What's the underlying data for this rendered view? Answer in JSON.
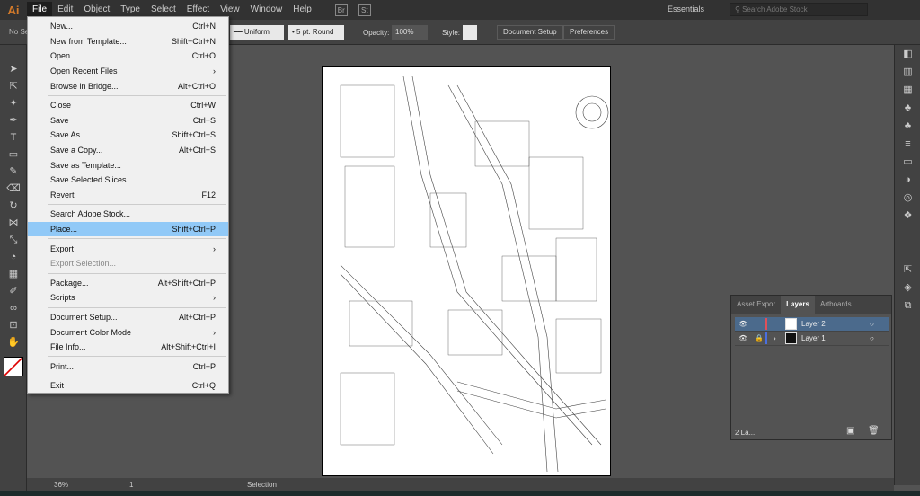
{
  "app": {
    "logo": "Ai"
  },
  "menubar": [
    "File",
    "Edit",
    "Object",
    "Type",
    "Select",
    "Effect",
    "View",
    "Window",
    "Help"
  ],
  "menubar_icons": {
    "bridge": "Br",
    "stock": "St"
  },
  "workspace": "Essentials",
  "search": {
    "placeholder": "Search Adobe Stock"
  },
  "control": {
    "selection": "No Se",
    "stroke": "Uniform",
    "brush": "5 pt. Round",
    "opacity_label": "Opacity:",
    "opacity": "100%",
    "style_label": "Style:",
    "doc_setup": "Document Setup",
    "preferences": "Preferences"
  },
  "file_menu": [
    {
      "label": "New...",
      "shortcut": "Ctrl+N"
    },
    {
      "label": "New from Template...",
      "shortcut": "Shift+Ctrl+N"
    },
    {
      "label": "Open...",
      "shortcut": "Ctrl+O"
    },
    {
      "label": "Open Recent Files",
      "shortcut": "›"
    },
    {
      "label": "Browse in Bridge...",
      "shortcut": "Alt+Ctrl+O",
      "sep": true
    },
    {
      "label": "Close",
      "shortcut": "Ctrl+W"
    },
    {
      "label": "Save",
      "shortcut": "Ctrl+S"
    },
    {
      "label": "Save As...",
      "shortcut": "Shift+Ctrl+S"
    },
    {
      "label": "Save a Copy...",
      "shortcut": "Alt+Ctrl+S"
    },
    {
      "label": "Save as Template...",
      "shortcut": ""
    },
    {
      "label": "Save Selected Slices...",
      "shortcut": ""
    },
    {
      "label": "Revert",
      "shortcut": "F12",
      "sep": true
    },
    {
      "label": "Search Adobe Stock...",
      "shortcut": ""
    },
    {
      "label": "Place...",
      "shortcut": "Shift+Ctrl+P",
      "highlight": true,
      "sep": true
    },
    {
      "label": "Export",
      "shortcut": "›"
    },
    {
      "label": "Export Selection...",
      "shortcut": "",
      "disabled": true,
      "sep": true
    },
    {
      "label": "Package...",
      "shortcut": "Alt+Shift+Ctrl+P"
    },
    {
      "label": "Scripts",
      "shortcut": "›",
      "sep": true
    },
    {
      "label": "Document Setup...",
      "shortcut": "Alt+Ctrl+P"
    },
    {
      "label": "Document Color Mode",
      "shortcut": "›"
    },
    {
      "label": "File Info...",
      "shortcut": "Alt+Shift+Ctrl+I",
      "sep": true
    },
    {
      "label": "Print...",
      "shortcut": "Ctrl+P",
      "sep": true
    },
    {
      "label": "Exit",
      "shortcut": "Ctrl+Q"
    }
  ],
  "layers_panel": {
    "tabs": [
      "Asset Expor",
      "Layers",
      "Artboards"
    ],
    "layers": [
      {
        "name": "Layer 2",
        "color": "#e0505a"
      },
      {
        "name": "Layer 1",
        "color": "#4a6fe0"
      }
    ],
    "count": "2 La..."
  },
  "status": {
    "zoom": "36%",
    "artboard": "1",
    "tool": "Selection"
  }
}
